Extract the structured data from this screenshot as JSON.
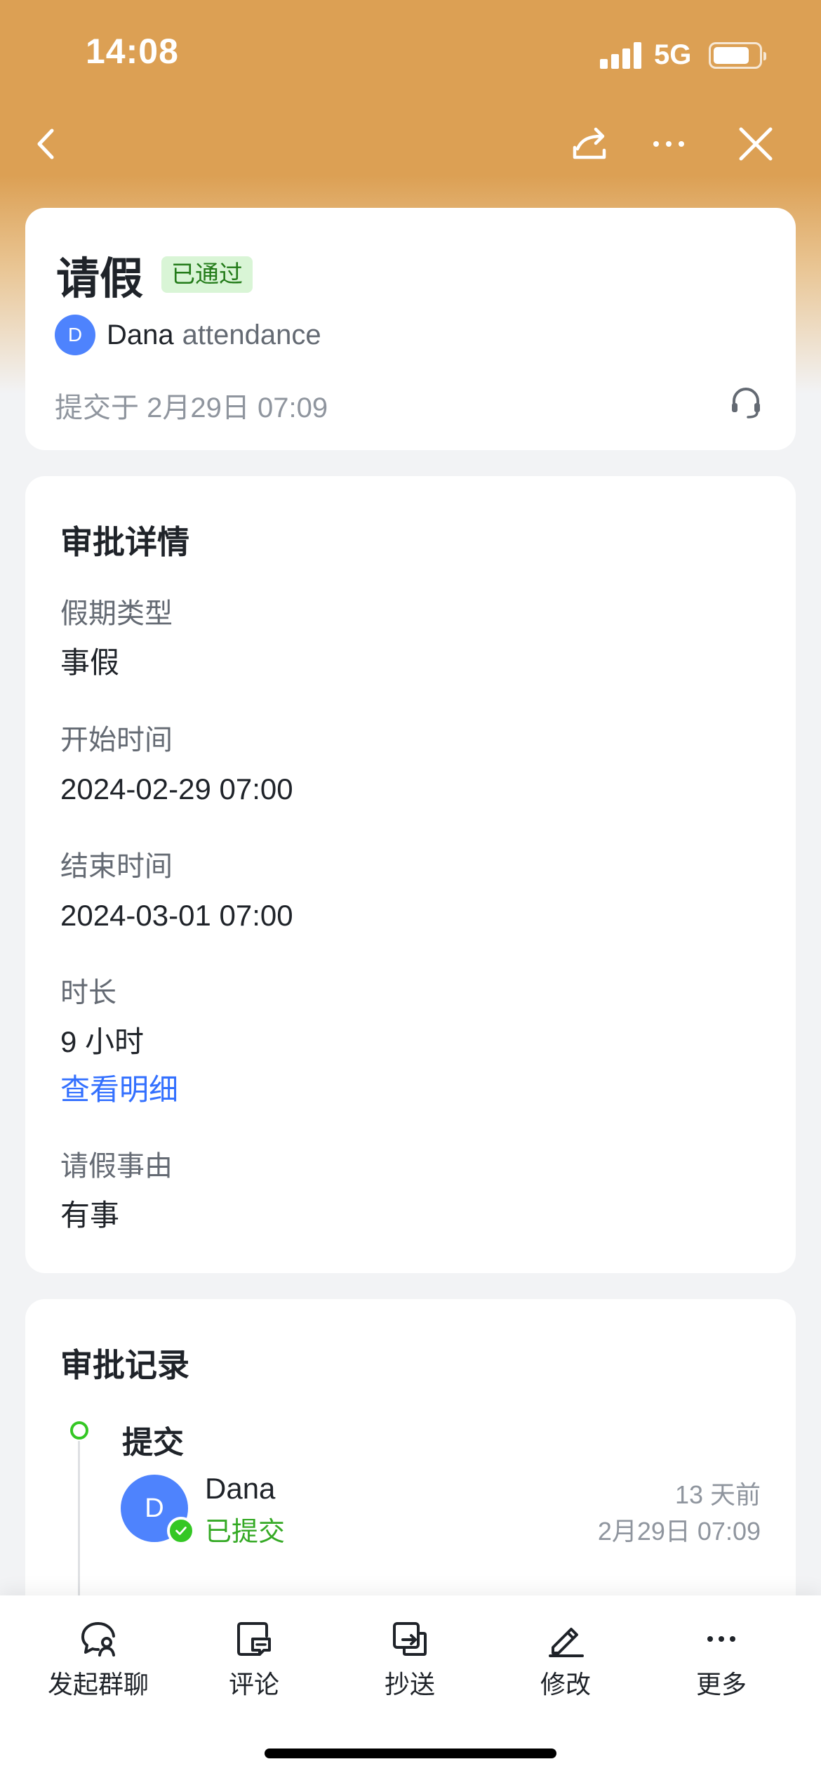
{
  "status_bar": {
    "time": "14:08",
    "network": "5G"
  },
  "nav": {
    "back_icon": "chevron-left-icon",
    "share_icon": "share-icon",
    "more_icon": "ellipsis-icon",
    "close_icon": "close-icon"
  },
  "header": {
    "title": "请假",
    "status_badge": "已通过",
    "applicant": {
      "avatar_initial": "D",
      "name": "Dana",
      "department": "attendance"
    },
    "submitted_at": "提交于 2月29日 07:09",
    "support_icon": "headset-icon"
  },
  "details": {
    "section_title": "审批详情",
    "fields": [
      {
        "label": "假期类型",
        "value": "事假"
      },
      {
        "label": "开始时间",
        "value": "2024-02-29 07:00"
      },
      {
        "label": "结束时间",
        "value": "2024-03-01 07:00"
      },
      {
        "label": "时长",
        "value": "9 小时",
        "link": "查看明细"
      },
      {
        "label": "请假事由",
        "value": "有事"
      }
    ]
  },
  "records": {
    "section_title": "审批记录",
    "steps": [
      {
        "title": "提交",
        "user_initial": "D",
        "user_name": "Dana",
        "status": "已提交",
        "relative_time": "13 天前",
        "time": "2月29日 07:09"
      }
    ]
  },
  "toolbar": {
    "items": [
      {
        "label": "发起群聊",
        "icon": "group-chat-icon"
      },
      {
        "label": "评论",
        "icon": "comment-icon"
      },
      {
        "label": "抄送",
        "icon": "cc-icon"
      },
      {
        "label": "修改",
        "icon": "edit-icon"
      },
      {
        "label": "更多",
        "icon": "more-icon"
      }
    ]
  },
  "colors": {
    "header_bg": "#dca054",
    "approved_badge_bg": "#d9f5d6",
    "approved_badge_text": "#237b19",
    "link": "#3370ff",
    "avatar": "#4e83fd",
    "success": "#34c724"
  }
}
